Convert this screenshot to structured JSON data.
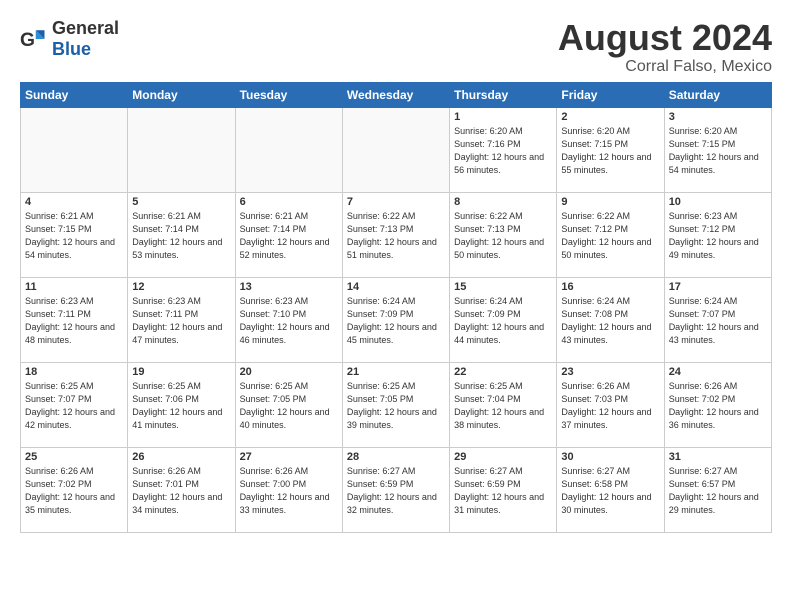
{
  "logo": {
    "general": "General",
    "blue": "Blue"
  },
  "title": {
    "month_year": "August 2024",
    "location": "Corral Falso, Mexico"
  },
  "weekdays": [
    "Sunday",
    "Monday",
    "Tuesday",
    "Wednesday",
    "Thursday",
    "Friday",
    "Saturday"
  ],
  "weeks": [
    [
      {
        "day": "",
        "empty": true
      },
      {
        "day": "",
        "empty": true
      },
      {
        "day": "",
        "empty": true
      },
      {
        "day": "",
        "empty": true
      },
      {
        "day": "1",
        "sunrise": "6:20 AM",
        "sunset": "7:16 PM",
        "daylight": "12 hours and 56 minutes."
      },
      {
        "day": "2",
        "sunrise": "6:20 AM",
        "sunset": "7:15 PM",
        "daylight": "12 hours and 55 minutes."
      },
      {
        "day": "3",
        "sunrise": "6:20 AM",
        "sunset": "7:15 PM",
        "daylight": "12 hours and 54 minutes."
      }
    ],
    [
      {
        "day": "4",
        "sunrise": "6:21 AM",
        "sunset": "7:15 PM",
        "daylight": "12 hours and 54 minutes."
      },
      {
        "day": "5",
        "sunrise": "6:21 AM",
        "sunset": "7:14 PM",
        "daylight": "12 hours and 53 minutes."
      },
      {
        "day": "6",
        "sunrise": "6:21 AM",
        "sunset": "7:14 PM",
        "daylight": "12 hours and 52 minutes."
      },
      {
        "day": "7",
        "sunrise": "6:22 AM",
        "sunset": "7:13 PM",
        "daylight": "12 hours and 51 minutes."
      },
      {
        "day": "8",
        "sunrise": "6:22 AM",
        "sunset": "7:13 PM",
        "daylight": "12 hours and 50 minutes."
      },
      {
        "day": "9",
        "sunrise": "6:22 AM",
        "sunset": "7:12 PM",
        "daylight": "12 hours and 50 minutes."
      },
      {
        "day": "10",
        "sunrise": "6:23 AM",
        "sunset": "7:12 PM",
        "daylight": "12 hours and 49 minutes."
      }
    ],
    [
      {
        "day": "11",
        "sunrise": "6:23 AM",
        "sunset": "7:11 PM",
        "daylight": "12 hours and 48 minutes."
      },
      {
        "day": "12",
        "sunrise": "6:23 AM",
        "sunset": "7:11 PM",
        "daylight": "12 hours and 47 minutes."
      },
      {
        "day": "13",
        "sunrise": "6:23 AM",
        "sunset": "7:10 PM",
        "daylight": "12 hours and 46 minutes."
      },
      {
        "day": "14",
        "sunrise": "6:24 AM",
        "sunset": "7:09 PM",
        "daylight": "12 hours and 45 minutes."
      },
      {
        "day": "15",
        "sunrise": "6:24 AM",
        "sunset": "7:09 PM",
        "daylight": "12 hours and 44 minutes."
      },
      {
        "day": "16",
        "sunrise": "6:24 AM",
        "sunset": "7:08 PM",
        "daylight": "12 hours and 43 minutes."
      },
      {
        "day": "17",
        "sunrise": "6:24 AM",
        "sunset": "7:07 PM",
        "daylight": "12 hours and 43 minutes."
      }
    ],
    [
      {
        "day": "18",
        "sunrise": "6:25 AM",
        "sunset": "7:07 PM",
        "daylight": "12 hours and 42 minutes."
      },
      {
        "day": "19",
        "sunrise": "6:25 AM",
        "sunset": "7:06 PM",
        "daylight": "12 hours and 41 minutes."
      },
      {
        "day": "20",
        "sunrise": "6:25 AM",
        "sunset": "7:05 PM",
        "daylight": "12 hours and 40 minutes."
      },
      {
        "day": "21",
        "sunrise": "6:25 AM",
        "sunset": "7:05 PM",
        "daylight": "12 hours and 39 minutes."
      },
      {
        "day": "22",
        "sunrise": "6:25 AM",
        "sunset": "7:04 PM",
        "daylight": "12 hours and 38 minutes."
      },
      {
        "day": "23",
        "sunrise": "6:26 AM",
        "sunset": "7:03 PM",
        "daylight": "12 hours and 37 minutes."
      },
      {
        "day": "24",
        "sunrise": "6:26 AM",
        "sunset": "7:02 PM",
        "daylight": "12 hours and 36 minutes."
      }
    ],
    [
      {
        "day": "25",
        "sunrise": "6:26 AM",
        "sunset": "7:02 PM",
        "daylight": "12 hours and 35 minutes."
      },
      {
        "day": "26",
        "sunrise": "6:26 AM",
        "sunset": "7:01 PM",
        "daylight": "12 hours and 34 minutes."
      },
      {
        "day": "27",
        "sunrise": "6:26 AM",
        "sunset": "7:00 PM",
        "daylight": "12 hours and 33 minutes."
      },
      {
        "day": "28",
        "sunrise": "6:27 AM",
        "sunset": "6:59 PM",
        "daylight": "12 hours and 32 minutes."
      },
      {
        "day": "29",
        "sunrise": "6:27 AM",
        "sunset": "6:59 PM",
        "daylight": "12 hours and 31 minutes."
      },
      {
        "day": "30",
        "sunrise": "6:27 AM",
        "sunset": "6:58 PM",
        "daylight": "12 hours and 30 minutes."
      },
      {
        "day": "31",
        "sunrise": "6:27 AM",
        "sunset": "6:57 PM",
        "daylight": "12 hours and 29 minutes."
      }
    ]
  ]
}
